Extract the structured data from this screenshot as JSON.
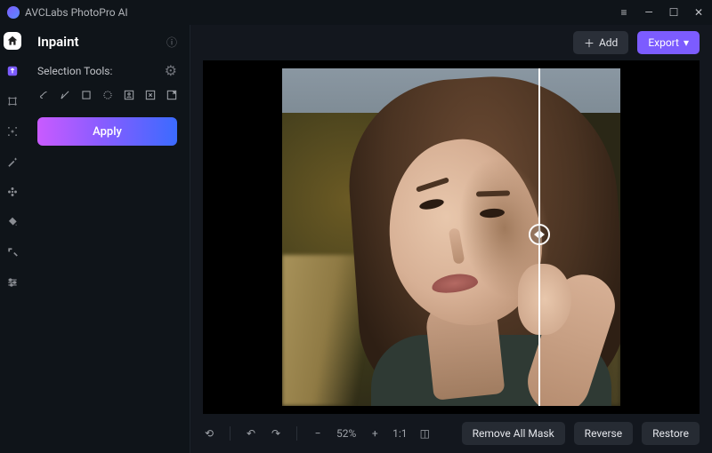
{
  "app": {
    "title": "AVCLabs PhotoPro AI"
  },
  "sidebar": {
    "mode_title": "Inpaint",
    "selection_label": "Selection Tools:",
    "apply_label": "Apply",
    "tools": [
      {
        "name": "brush"
      },
      {
        "name": "polygon"
      },
      {
        "name": "rectangle"
      },
      {
        "name": "circle"
      },
      {
        "name": "portrait-select"
      },
      {
        "name": "auto-select"
      },
      {
        "name": "expand-select"
      }
    ]
  },
  "rail": {
    "items": [
      {
        "name": "home",
        "active": true
      },
      {
        "name": "upload"
      },
      {
        "name": "ai-enhance"
      },
      {
        "name": "sparkle-center"
      },
      {
        "name": "magic-wand"
      },
      {
        "name": "flower"
      },
      {
        "name": "paint-bucket"
      },
      {
        "name": "expand-arrow"
      },
      {
        "name": "sliders"
      }
    ]
  },
  "topbar": {
    "add_label": "Add",
    "export_label": "Export"
  },
  "bottombar": {
    "zoom_value": "52%",
    "ratio_label": "1:1",
    "remove_mask_label": "Remove All Mask",
    "reverse_label": "Reverse",
    "restore_label": "Restore"
  }
}
